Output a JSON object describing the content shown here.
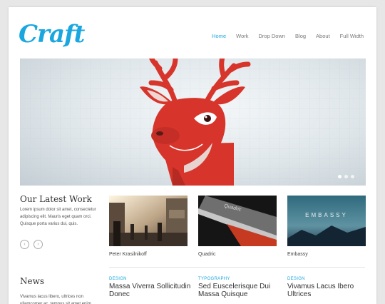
{
  "brand": {
    "logo_text": "Craft",
    "accent": "#1aa7e0"
  },
  "nav": {
    "items": [
      "Home",
      "Work",
      "Drop Down",
      "Blog",
      "About",
      "Full Width"
    ],
    "active": "Home"
  },
  "hero": {
    "slides": 3,
    "active_slide": 1
  },
  "work": {
    "title": "Our Latest Work",
    "intro": "Lorem ipsum dolor sit amet, consectetur adipiscing elit. Mauris eget quam orci. Quisque porta varius dui, quis.",
    "prev_icon": "chevron-left-icon",
    "next_icon": "chevron-right-icon",
    "items": [
      {
        "caption": "Peter Krasilnikoff"
      },
      {
        "caption": "Quadric"
      },
      {
        "caption": "Embassy"
      }
    ],
    "quadric_word": "Quadric",
    "embassy_word": "EMBASSY"
  },
  "news": {
    "title": "News",
    "intro": "Vivamus lacus libero, ultrices non ullamcorper ac, tempus sit amet enim.",
    "posts": [
      {
        "tag": "DESIGN",
        "title": "Massa Viverra Sollicitudin Donec"
      },
      {
        "tag": "TYPOGRAPHY",
        "title": "Sed Euscelerisque Dui Massa Quisque"
      },
      {
        "tag": "DESIGN",
        "title": "Vivamus Lacus Ibero Ultrices"
      }
    ]
  }
}
